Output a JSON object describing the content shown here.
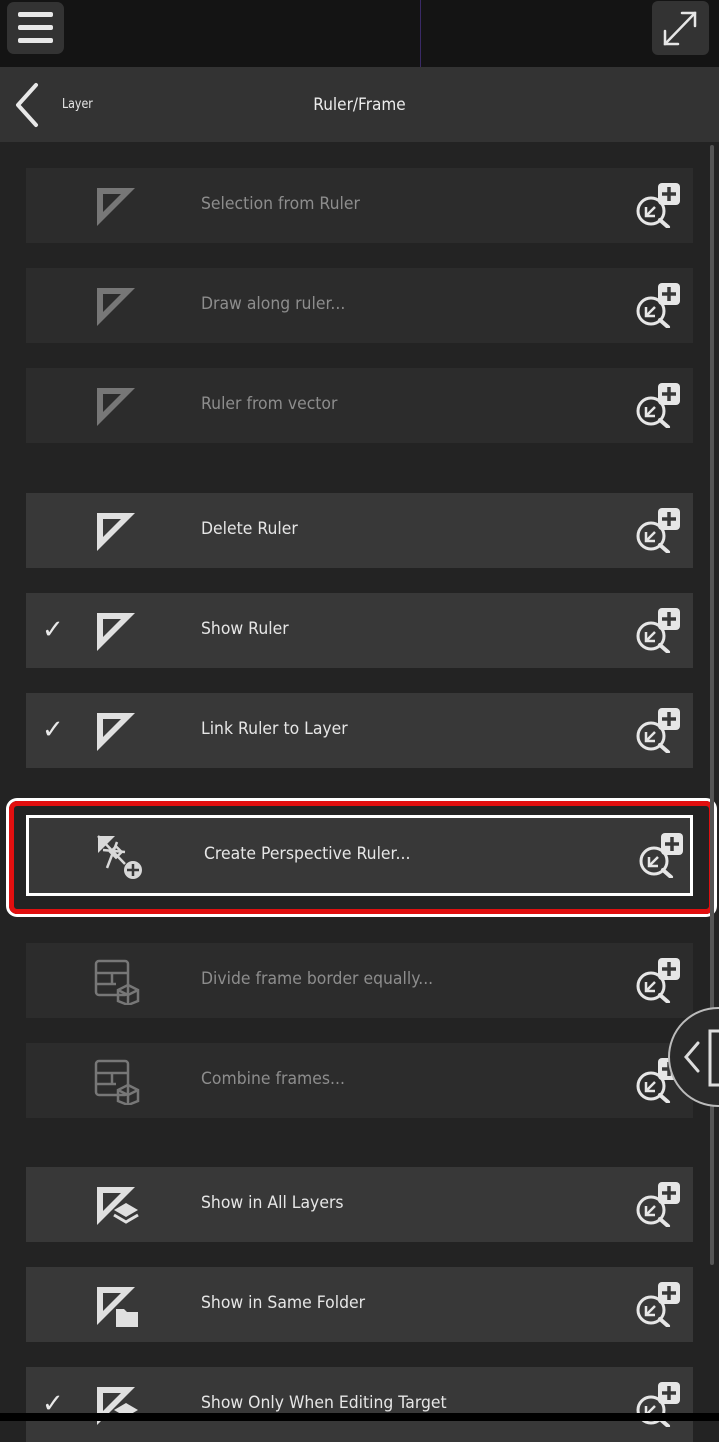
{
  "navbar": {
    "back_label": "Layer",
    "title": "Ruler/Frame"
  },
  "topbar": {
    "menu_icon": "hamburger-menu-icon",
    "expand_icon": "expand-arrows-icon"
  },
  "items": [
    {
      "label": "Selection from Ruler",
      "checked": false,
      "enabled": false,
      "icon": "ruler-icon"
    },
    {
      "label": "Draw along ruler...",
      "checked": false,
      "enabled": false,
      "icon": "ruler-icon"
    },
    {
      "label": "Ruler from vector",
      "checked": false,
      "enabled": false,
      "icon": "ruler-icon"
    },
    {
      "label": "Delete Ruler",
      "checked": false,
      "enabled": true,
      "icon": "ruler-icon"
    },
    {
      "label": "Show Ruler",
      "checked": true,
      "enabled": true,
      "icon": "ruler-icon"
    },
    {
      "label": "Link Ruler to Layer",
      "checked": true,
      "enabled": true,
      "icon": "ruler-icon"
    },
    {
      "label": "Create Perspective Ruler...",
      "checked": false,
      "enabled": true,
      "icon": "perspective-ruler-add-icon",
      "highlighted": true
    },
    {
      "label": "Divide frame border equally...",
      "checked": false,
      "enabled": false,
      "icon": "frame-border-icon"
    },
    {
      "label": "Combine frames...",
      "checked": false,
      "enabled": false,
      "icon": "frame-border-icon"
    },
    {
      "label": "Show in All Layers",
      "checked": false,
      "enabled": true,
      "icon": "ruler-layers-icon"
    },
    {
      "label": "Show in Same Folder",
      "checked": false,
      "enabled": true,
      "icon": "ruler-folder-icon"
    },
    {
      "label": "Show Only When Editing Target",
      "checked": true,
      "enabled": true,
      "icon": "ruler-target-icon"
    }
  ],
  "check_glyph": "✓",
  "colors": {
    "highlight": "#e10f0f",
    "row_enabled": "#383838",
    "row_disabled": "#2c2c2c"
  }
}
